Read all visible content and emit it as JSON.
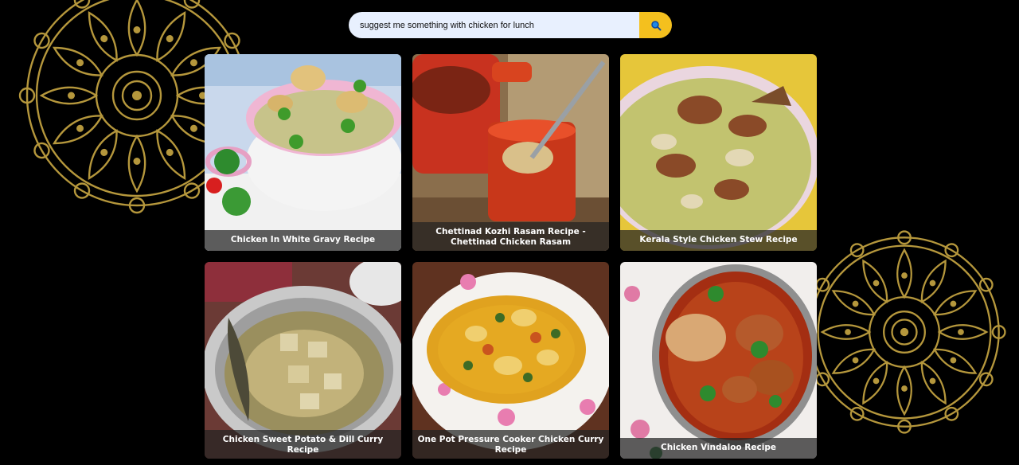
{
  "search": {
    "value": "suggest me something with chicken for lunch",
    "button_icon": "search-icon"
  },
  "colors": {
    "background": "#000000",
    "accent": "#f4c01e",
    "input_bg": "#e8f0fe",
    "mandala": "#b5973c",
    "caption_bg": "rgba(35,35,35,0.72)"
  },
  "recipes": [
    {
      "title": "Chicken In White Gravy Recipe"
    },
    {
      "title": "Chettinad Kozhi Rasam Recipe - Chettinad Chicken Rasam"
    },
    {
      "title": "Kerala Style Chicken Stew Recipe"
    },
    {
      "title": "Chicken Sweet Potato & Dill Curry Recipe"
    },
    {
      "title": "One Pot Pressure Cooker Chicken Curry Recipe"
    },
    {
      "title": "Chicken Vindaloo Recipe"
    }
  ]
}
